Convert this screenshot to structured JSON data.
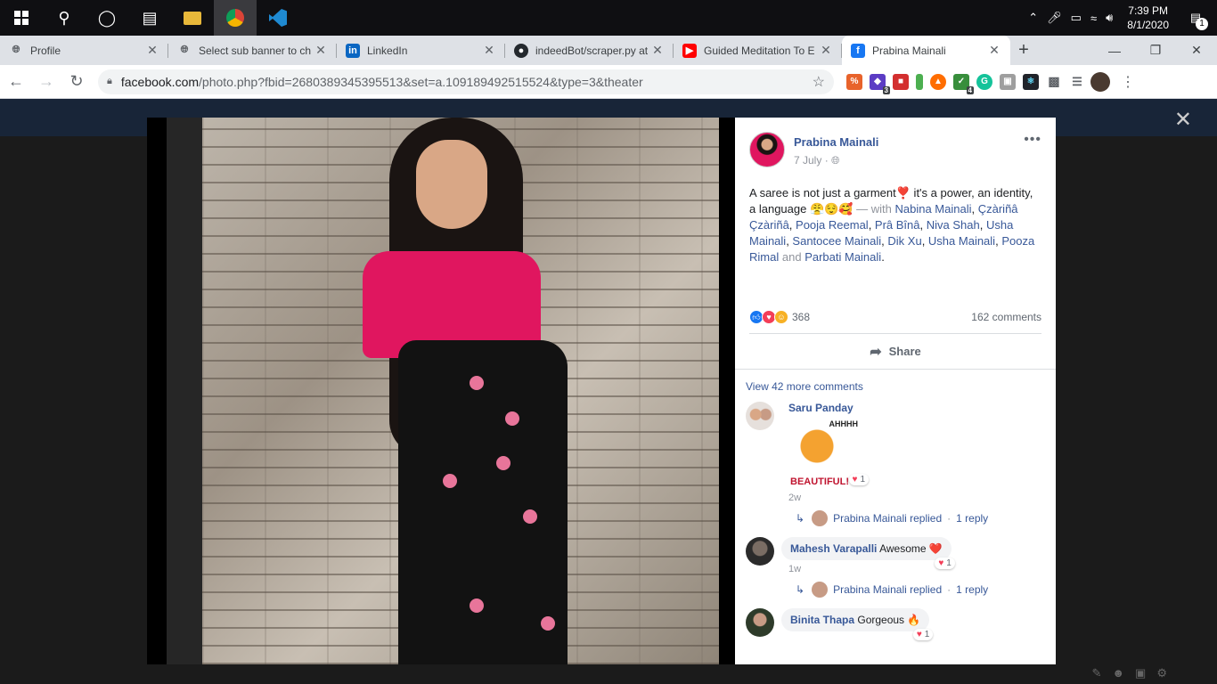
{
  "taskbar": {
    "time": "7:39 PM",
    "date": "8/1/2020",
    "notifications": "1"
  },
  "tabs": [
    {
      "title": "Profile",
      "favicon": "globe"
    },
    {
      "title": "Select sub banner to ch",
      "favicon": "globe"
    },
    {
      "title": "LinkedIn",
      "favicon": "in"
    },
    {
      "title": "indeedBot/scraper.py at",
      "favicon": "github"
    },
    {
      "title": "Guided Meditation To E",
      "favicon": "youtube"
    },
    {
      "title": "Prabina Mainali",
      "favicon": "f"
    }
  ],
  "address": {
    "host": "facebook.com",
    "path": "/photo.php?fbid=2680389345395513&set=a.109189492515524&type=3&theater"
  },
  "extensions": [
    {
      "name": "ext-1",
      "color": "#e8632b",
      "badge": ""
    },
    {
      "name": "ext-2",
      "color": "#5b3cc4",
      "badge": "3"
    },
    {
      "name": "ext-3",
      "color": "#d32f2f",
      "badge": ""
    },
    {
      "name": "ext-4",
      "color": "#4caf50",
      "badge": ""
    },
    {
      "name": "ext-5",
      "color": "#ff6d00",
      "badge": ""
    },
    {
      "name": "ext-6",
      "color": "#388e3c",
      "badge": "4"
    },
    {
      "name": "ext-7",
      "color": "#15c39a",
      "badge": ""
    },
    {
      "name": "ext-8",
      "color": "#757575",
      "badge": ""
    },
    {
      "name": "ext-9",
      "color": "#1565c0",
      "badge": ""
    }
  ],
  "post": {
    "author": "Prabina Mainali",
    "date": "7 July",
    "caption_text": "A saree is not just a garment❣️ it's a power, an identity, a language 😤😌🥰",
    "with_label": "— with",
    "tags": [
      "Nabina Mainali",
      "Çzàriñâ Çzàriñâ",
      "Pooja Reemal",
      "Prâ Bînâ",
      "Niva Shah",
      "Usha Mainali",
      "Santocee Mainali",
      "Dik Xu",
      "Usha Mainali",
      "Pooza Rimal"
    ],
    "and_label": "and",
    "last_tag": "Parbati Mainali",
    "reaction_count": "368",
    "comment_count": "162 comments",
    "share_label": "Share",
    "view_more": "View 42 more comments"
  },
  "comments": [
    {
      "name": "Saru Panday",
      "text": "",
      "time": "2w",
      "likes": "1",
      "sticker_top": "AHHHH",
      "sticker_bottom": "BEAUTIFUL!"
    },
    {
      "name": "Mahesh Varapalli",
      "text": "Awesome ❤️",
      "time": "1w",
      "likes": "1"
    },
    {
      "name": "Binita Thapa",
      "text": "Gorgeous 🔥",
      "time": "",
      "likes": "1"
    }
  ],
  "replies": [
    {
      "text": "Prabina Mainali replied",
      "count": "1 reply"
    },
    {
      "text": "Prabina Mainali replied",
      "count": "1 reply"
    }
  ]
}
